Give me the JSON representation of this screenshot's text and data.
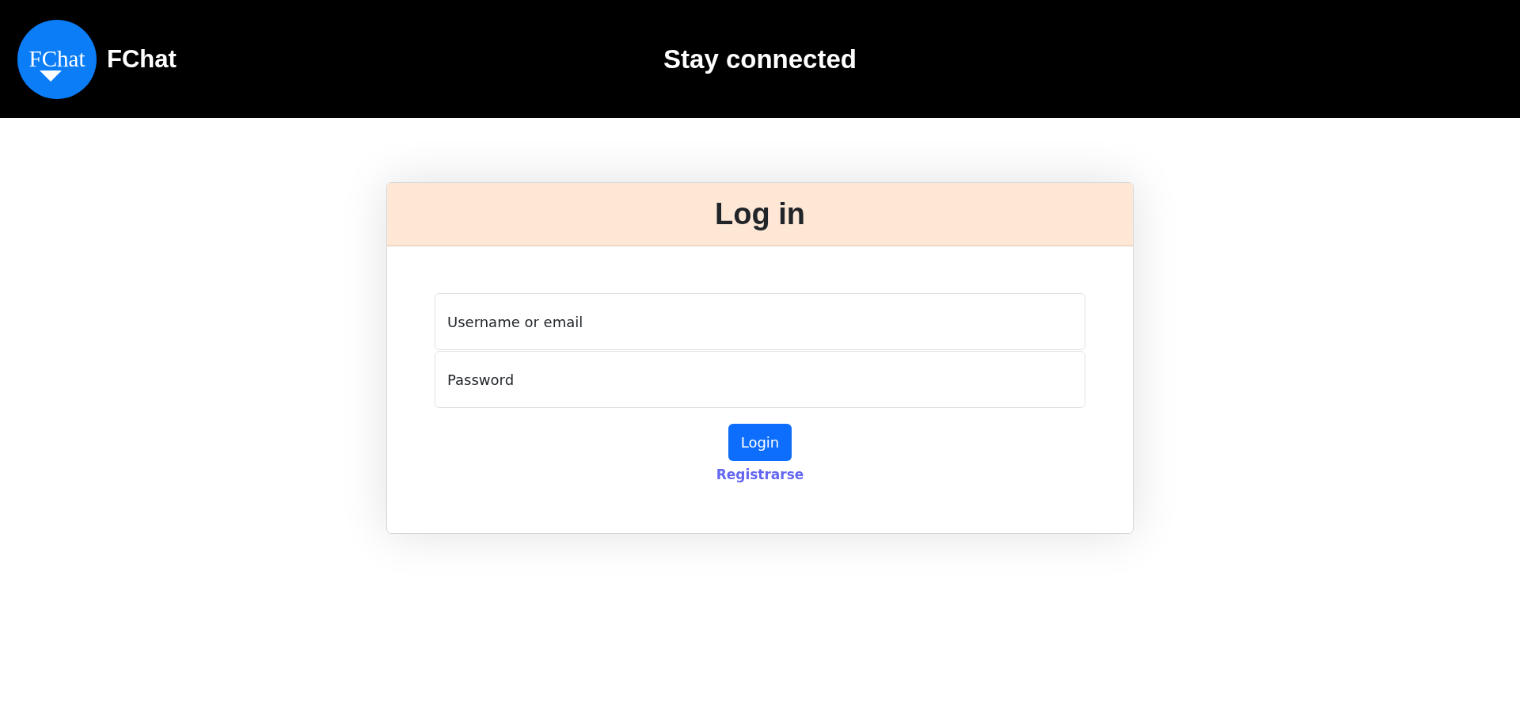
{
  "header": {
    "logo_text": "FChat",
    "brand": "FChat",
    "title": "Stay connected"
  },
  "login_card": {
    "title": "Log in",
    "fields": [
      {
        "placeholder": "Username or email"
      },
      {
        "placeholder": "Password"
      }
    ],
    "button": "Login",
    "link": "Registrarse"
  }
}
